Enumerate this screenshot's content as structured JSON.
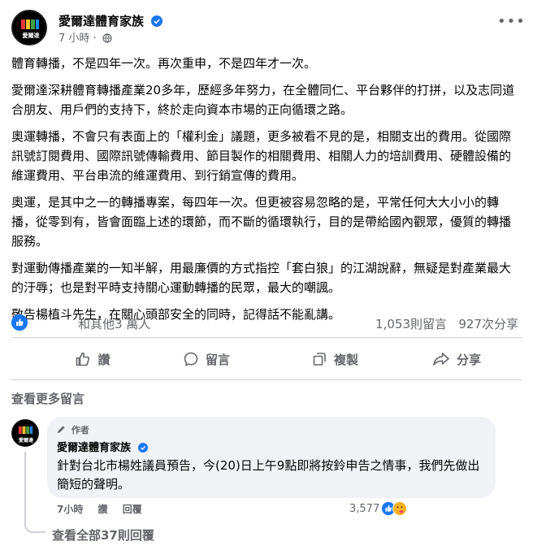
{
  "post": {
    "page_name": "愛爾達體育家族",
    "time": "7 小時",
    "meta_separator": "·",
    "avatar_text": "愛爾達",
    "paragraphs": [
      "體育轉播，不是四年一次。再次重申，不是四年才一次。",
      "愛爾達深耕體育轉播產業20多年，歷經多年努力，在全體同仁、平台夥伴的打拼，以及志同道合朋友、用戶們的支持下，終於走向資本市場的正向循環之路。",
      "奧運轉播，不會只有表面上的「權利金」議題，更多被看不見的是，相關支出的費用。從國際訊號訂閱費用、國際訊號傳輸費用、節目製作的相關費用、相關人力的培訓費用、硬體設備的維運費用、平台串流的維運費用、到行銷宣傳的費用。",
      "奧運，是其中之一的轉播專案，每四年一次。但更被容易忽略的是，平常任何大大小小的轉播，從零到有，皆會面臨上述的環節，而不斷的循環執行，目的是帶給國內觀眾，優質的轉播服務。",
      "對運動傳播產業的一知半解，用最廉價的方式指控「套白狼」的江湖說辭，無疑是對產業最大的汙辱；也是對平時支持關心運動轉播的民眾，最大的嘲諷。",
      "敬告楊植斗先生，在關心頭部安全的同時，記得話不能亂講。"
    ]
  },
  "stats": {
    "reactions_text": "和其他3 萬人",
    "comment_count": "1,053則留言",
    "share_count": "927次分享"
  },
  "actions": {
    "like_label": "讚",
    "comment_label": "留言",
    "copy_label": "複製",
    "share_label": "分享"
  },
  "comments_section": {
    "more_comments_label": "查看更多留言",
    "comment": {
      "author_tag": "作者",
      "name": "愛爾達體育家族",
      "text": "針對台北市楊姓議員預告，今(20)日上午9點即將按鈴申告之情事，我們先做出簡短的聲明。",
      "time": "7小時",
      "like_label": "讚",
      "reply_label": "回覆",
      "reaction_count": "3,577"
    },
    "view_replies_label": "查看全部37則回覆"
  },
  "colors": {
    "brand_blue": "#1877f2",
    "secondary_text": "#65676b",
    "bubble_bg": "#f0f2f5",
    "divider": "#ced0d4"
  }
}
